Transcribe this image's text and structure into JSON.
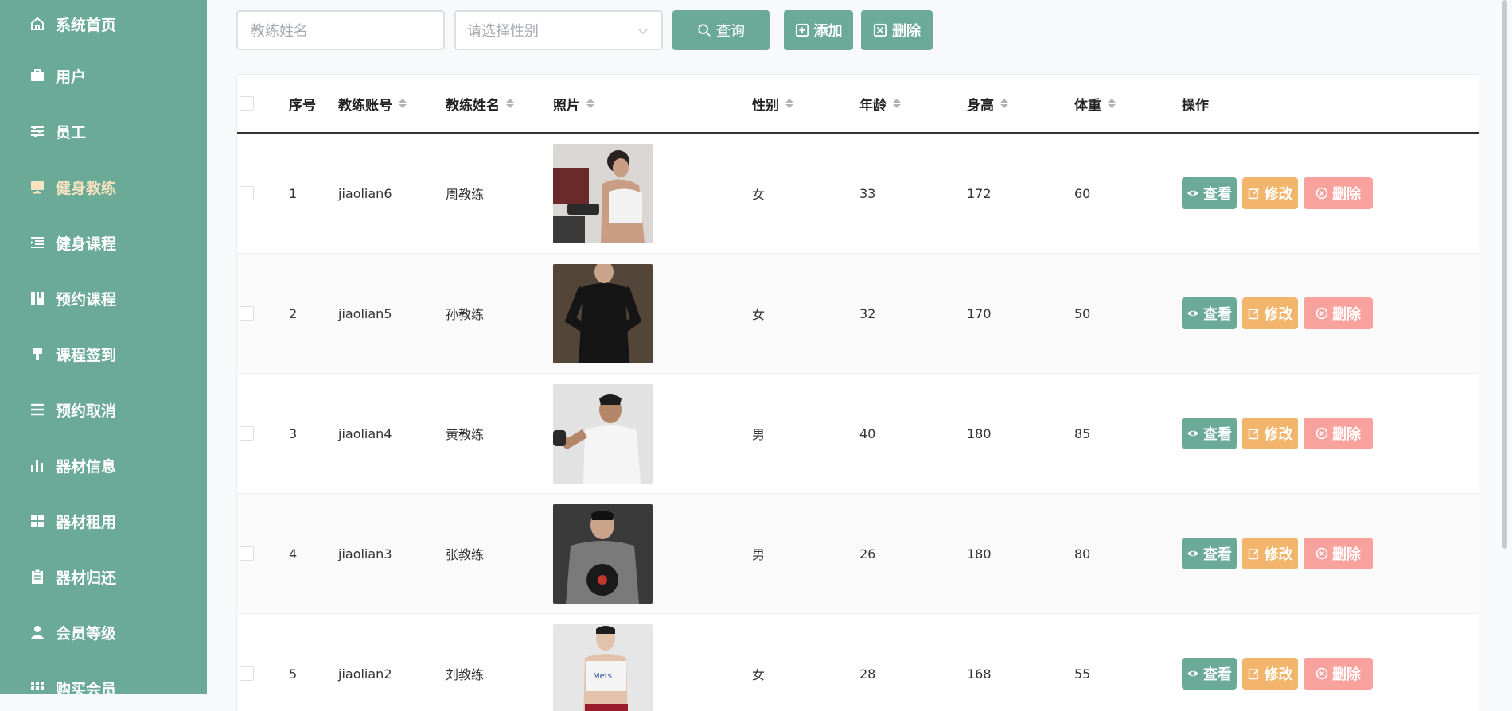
{
  "sidebar": {
    "items": [
      {
        "label": "系统首页",
        "icon": "home-icon"
      },
      {
        "label": "用户",
        "icon": "briefcase-icon"
      },
      {
        "label": "员工",
        "icon": "sliders-icon"
      },
      {
        "label": "健身教练",
        "icon": "monitor-icon",
        "active": true
      },
      {
        "label": "健身课程",
        "icon": "list-icon"
      },
      {
        "label": "预约课程",
        "icon": "book-icon"
      },
      {
        "label": "课程签到",
        "icon": "brush-icon"
      },
      {
        "label": "预约取消",
        "icon": "menu-icon"
      },
      {
        "label": "器材信息",
        "icon": "bar-chart-icon"
      },
      {
        "label": "器材租用",
        "icon": "grid-icon"
      },
      {
        "label": "器材归还",
        "icon": "clipboard-icon"
      },
      {
        "label": "会员等级",
        "icon": "user-icon"
      },
      {
        "label": "购买会员",
        "icon": "grid-dots-icon"
      }
    ]
  },
  "toolbar": {
    "name_placeholder": "教练姓名",
    "gender_placeholder": "请选择性别",
    "search_label": "查询",
    "add_label": "添加",
    "delete_label": "删除"
  },
  "table": {
    "headers": {
      "index": "序号",
      "account": "教练账号",
      "name": "教练姓名",
      "photo": "照片",
      "gender": "性别",
      "age": "年龄",
      "height": "身高",
      "weight": "体重",
      "actions": "操作"
    },
    "rows": [
      {
        "index": "1",
        "account": "jiaolian6",
        "name": "周教练",
        "gender": "女",
        "age": "33",
        "height": "172",
        "weight": "60"
      },
      {
        "index": "2",
        "account": "jiaolian5",
        "name": "孙教练",
        "gender": "女",
        "age": "32",
        "height": "170",
        "weight": "50"
      },
      {
        "index": "3",
        "account": "jiaolian4",
        "name": "黄教练",
        "gender": "男",
        "age": "40",
        "height": "180",
        "weight": "85"
      },
      {
        "index": "4",
        "account": "jiaolian3",
        "name": "张教练",
        "gender": "男",
        "age": "26",
        "height": "180",
        "weight": "80"
      },
      {
        "index": "5",
        "account": "jiaolian2",
        "name": "刘教练",
        "gender": "女",
        "age": "28",
        "height": "168",
        "weight": "55"
      }
    ],
    "actions": {
      "view": "查看",
      "edit": "修改",
      "delete": "删除"
    }
  },
  "colors": {
    "primary": "#6aaa97",
    "edit": "#f3b46b",
    "delete": "#f8a19d",
    "active_nav": "#f7e3bf"
  }
}
